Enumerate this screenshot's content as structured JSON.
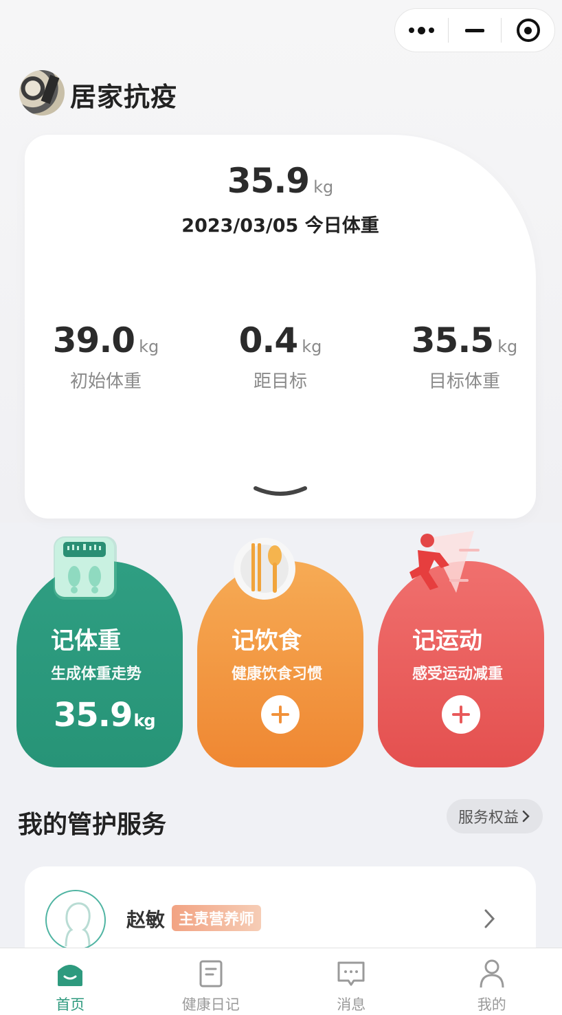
{
  "capsule": {
    "more_icon": "more-dots-icon",
    "minimize_icon": "minimize-icon",
    "close_icon": "target-close-icon"
  },
  "header": {
    "title": "居家抗疫"
  },
  "weight_card": {
    "today_value": "35.9",
    "today_unit": "kg",
    "today_label": "2023/03/05 今日体重",
    "stats": [
      {
        "value": "39.0",
        "unit": "kg",
        "label": "初始体重"
      },
      {
        "value": "0.4",
        "unit": "kg",
        "label": "距目标"
      },
      {
        "value": "35.5",
        "unit": "kg",
        "label": "目标体重"
      }
    ]
  },
  "actions": {
    "weight": {
      "title": "记体重",
      "subtitle": "生成体重走势",
      "value": "35.9",
      "unit": "kg",
      "color": "#2a9a7c"
    },
    "diet": {
      "title": "记饮食",
      "subtitle": "健康饮食习惯",
      "color": "#f29a40"
    },
    "exercise": {
      "title": "记运动",
      "subtitle": "感受运动减重",
      "color": "#ea5f5e"
    }
  },
  "services": {
    "title": "我的管护服务",
    "rights_button": "服务权益",
    "nutritionist": {
      "name": "赵敏",
      "role": "主责营养师"
    }
  },
  "tabbar": {
    "items": [
      {
        "label": "首页",
        "icon": "home-icon",
        "active": true
      },
      {
        "label": "健康日记",
        "icon": "diary-icon",
        "active": false
      },
      {
        "label": "消息",
        "icon": "message-icon",
        "active": false
      },
      {
        "label": "我的",
        "icon": "profile-icon",
        "active": false
      }
    ],
    "active_color": "#2e9a7e"
  }
}
